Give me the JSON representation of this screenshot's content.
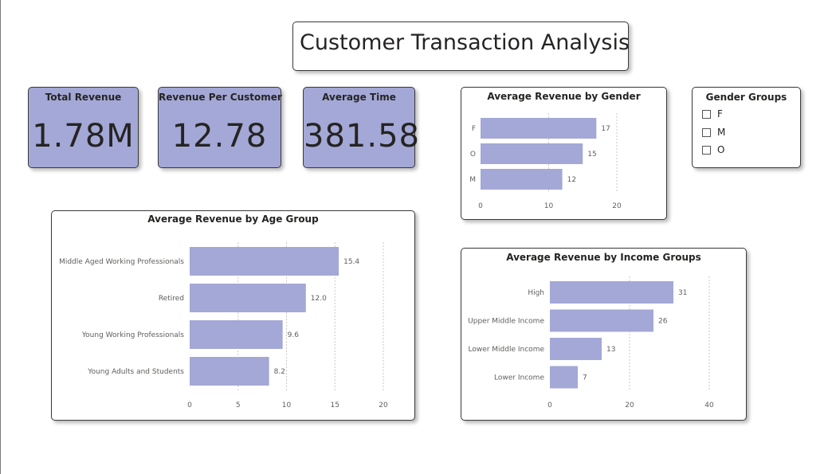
{
  "header": {
    "title": "Customer Transaction Analysis"
  },
  "kpis": [
    {
      "label": "Total Revenue",
      "value": "1.78M"
    },
    {
      "label": "Revenue Per Customer",
      "value": "12.78"
    },
    {
      "label": "Average Time",
      "value": "381.58"
    }
  ],
  "slicer": {
    "title": "Gender Groups",
    "options": [
      {
        "label": "F",
        "checked": false
      },
      {
        "label": "M",
        "checked": false
      },
      {
        "label": "O",
        "checked": false
      }
    ]
  },
  "colors": {
    "bar": "#a4a8d6",
    "kpi_background": "#a4a8d6",
    "gridline": "#c8c8c8"
  },
  "chart_data": [
    {
      "id": "gender",
      "type": "bar",
      "orientation": "horizontal",
      "title": "Average Revenue by Gender",
      "categories": [
        "F",
        "O",
        "M"
      ],
      "values": [
        17,
        15,
        12
      ],
      "value_labels": [
        "17",
        "15",
        "12"
      ],
      "xlim": [
        0,
        20
      ],
      "xticks": [
        0,
        10,
        20
      ],
      "grid": true
    },
    {
      "id": "age",
      "type": "bar",
      "orientation": "horizontal",
      "title": "Average Revenue by Age Group",
      "categories": [
        "Middle Aged Working Professionals",
        "Retired",
        "Young Working Professionals",
        "Young Adults and Students"
      ],
      "values": [
        15.4,
        12.0,
        9.6,
        8.2
      ],
      "value_labels": [
        "15.4",
        "12.0",
        "9.6",
        "8.2"
      ],
      "xlim": [
        0,
        20
      ],
      "xticks": [
        0,
        5,
        10,
        15,
        20
      ],
      "grid": true
    },
    {
      "id": "income",
      "type": "bar",
      "orientation": "horizontal",
      "title": "Average Revenue by Income Groups",
      "categories": [
        "High",
        "Upper Middle Income",
        "Lower Middle Income",
        "Lower Income"
      ],
      "values": [
        31,
        26,
        13,
        7
      ],
      "value_labels": [
        "31",
        "26",
        "13",
        "7"
      ],
      "xlim": [
        0,
        40
      ],
      "xticks": [
        0,
        20,
        40
      ],
      "grid": true
    }
  ]
}
